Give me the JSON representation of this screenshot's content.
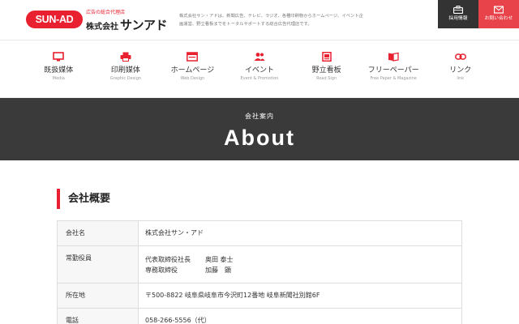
{
  "header": {
    "logo_badge": "SUN-AD",
    "logo_sub": "広告の総合代理店",
    "logo_company": "株式会社",
    "logo_name": "サンアド",
    "tagline": "株式会社サン・アドは、新聞広告、テレビ、ラジオ、各種印刷物からホームページ、イベント企画運営、野立看板までをトータルサポートする総合広告代理店です。",
    "recruit_label": "採用情報",
    "contact_label": "お問い合わせ",
    "recruit_icon": "briefcase-icon",
    "contact_icon": "mail-icon",
    "recruit_color": "#333333",
    "contact_color": "#e8434a",
    "brand_color": "#e8202f"
  },
  "nav": {
    "items": [
      {
        "jp": "既扱媒体",
        "en": "Media",
        "icon": "monitor-icon"
      },
      {
        "jp": "印刷媒体",
        "en": "Graphic Design",
        "icon": "printer-icon"
      },
      {
        "jp": "ホームページ",
        "en": "Web Design",
        "icon": "browser-icon"
      },
      {
        "jp": "イベント",
        "en": "Event & Promotion",
        "icon": "people-icon"
      },
      {
        "jp": "野立看板",
        "en": "Road Sign",
        "icon": "signboard-icon"
      },
      {
        "jp": "フリーペーパー",
        "en": "Free Paper & Magazine",
        "icon": "book-icon"
      },
      {
        "jp": "リンク",
        "en": "link",
        "icon": "link-icon"
      }
    ]
  },
  "hero": {
    "small": "会社案内",
    "title": "About"
  },
  "main": {
    "section_title": "会社概要",
    "table": {
      "name_label": "会社名",
      "name_value": "株式会社サン・アド",
      "officers_label": "常勤役員",
      "officers": [
        {
          "position": "代表取締役社長",
          "name": "奥田 泰士"
        },
        {
          "position": "専務取締役",
          "name": "加藤　顕"
        }
      ],
      "address_label": "所在地",
      "address_value": "〒500-8822 岐阜県岐阜市今沢町12番地 岐阜新聞社別館6F",
      "tel_label": "電話",
      "tel_value": "058-266-5556（代）"
    }
  }
}
